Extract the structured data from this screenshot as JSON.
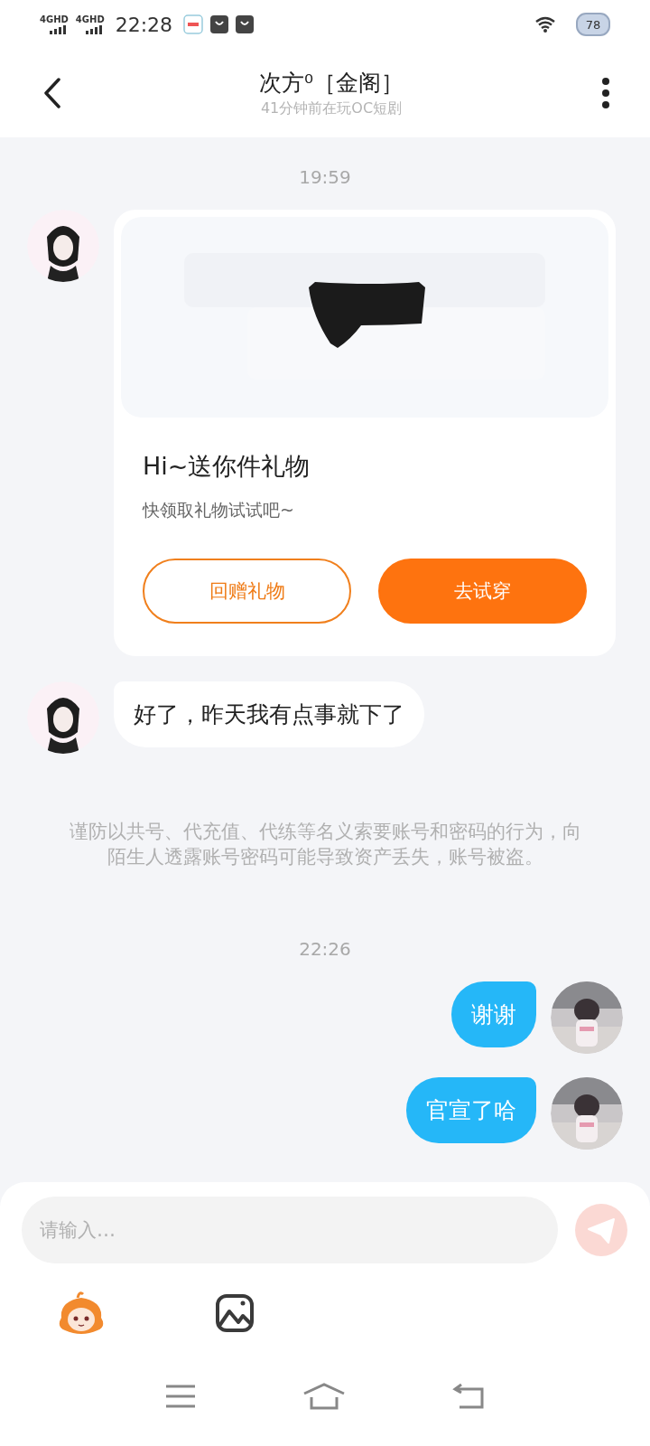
{
  "status_bar": {
    "signals": [
      "4GHD",
      "4GHD"
    ],
    "time": "22:28",
    "battery": "78"
  },
  "header": {
    "title": "次方⁰［金阁］",
    "subtitle": "41分钟前在玩OC短剧"
  },
  "messages": [
    {
      "kind": "time",
      "text": "19:59"
    },
    {
      "kind": "gift",
      "outgoing": false,
      "title": "Hi~送你件礼物",
      "subtitle": "快领取礼物试试吧~",
      "buttons": [
        {
          "label": "回赠礼物",
          "primary": false
        },
        {
          "label": "去试穿",
          "primary": true
        }
      ]
    },
    {
      "kind": "text",
      "outgoing": false,
      "text": "好了，昨天我有点事就下了"
    },
    {
      "kind": "notice",
      "text": "谨防以共号、代充值、代练等名义索要账号和密码的行为，向陌生人透露账号密码可能导致资产丢失，账号被盗。"
    },
    {
      "kind": "time",
      "text": "22:26"
    },
    {
      "kind": "text",
      "outgoing": true,
      "text": "谢谢"
    },
    {
      "kind": "text",
      "outgoing": true,
      "text": "官宣了哈"
    }
  ],
  "composer": {
    "placeholder": "请输入…"
  }
}
